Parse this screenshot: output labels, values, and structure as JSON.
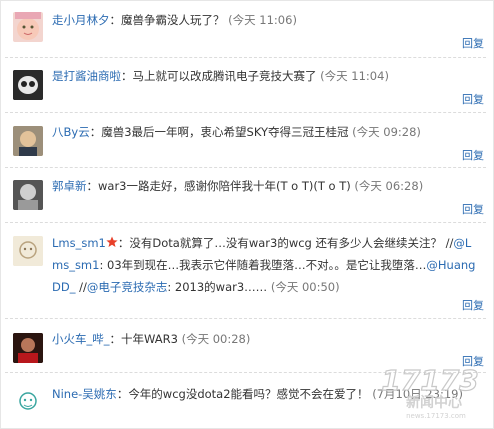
{
  "comments": [
    {
      "name": "走小月林夕",
      "text": "魔兽争霸没人玩了？",
      "time": "(今天 11:06)",
      "reply": "回复"
    },
    {
      "name": "是打酱油商啦",
      "text": "马上就可以改成腾讯电子竞技大赛了",
      "time": "(今天 11:04)",
      "reply": "回复"
    },
    {
      "name": "八By云",
      "text": "魔兽3最后一年啊，衷心希望SKY夺得三冠王桂冠",
      "time": "(今天 09:28)",
      "reply": "回复"
    },
    {
      "name": "郭卓新",
      "text": "war3一路走好，感谢你陪伴我十年(T o T)(T o T)",
      "time": "(今天 06:28)",
      "reply": "回复"
    },
    {
      "name": "Lms_sm1",
      "p1": "没有Dota就算了…没有war3的wcg 还有多少人会继续关注？ //",
      "m1": "@Lms_sm1",
      "p2": ": 03年到现在…我表示它伴随着我堕落…不对。。是它让我堕落…",
      "m2": "@HuangDD_",
      "p3": " //",
      "m3": "@电子竞技杂志",
      "p4": ": 2013的war3……",
      "time": "(今天 00:50)",
      "reply": "回复"
    },
    {
      "name": "小火车_哔_",
      "text": "十年WAR3",
      "time": "(今天 00:28)",
      "reply": "回复"
    },
    {
      "name": "Nine-吴姚东",
      "text": "今年的wcg没dota2能看吗？感觉不会在爱了！",
      "time": "(7月10日 23:19)"
    }
  ],
  "watermark": {
    "logo": "17173",
    "caption": "新闻中心",
    "url": "news.17173.com"
  }
}
